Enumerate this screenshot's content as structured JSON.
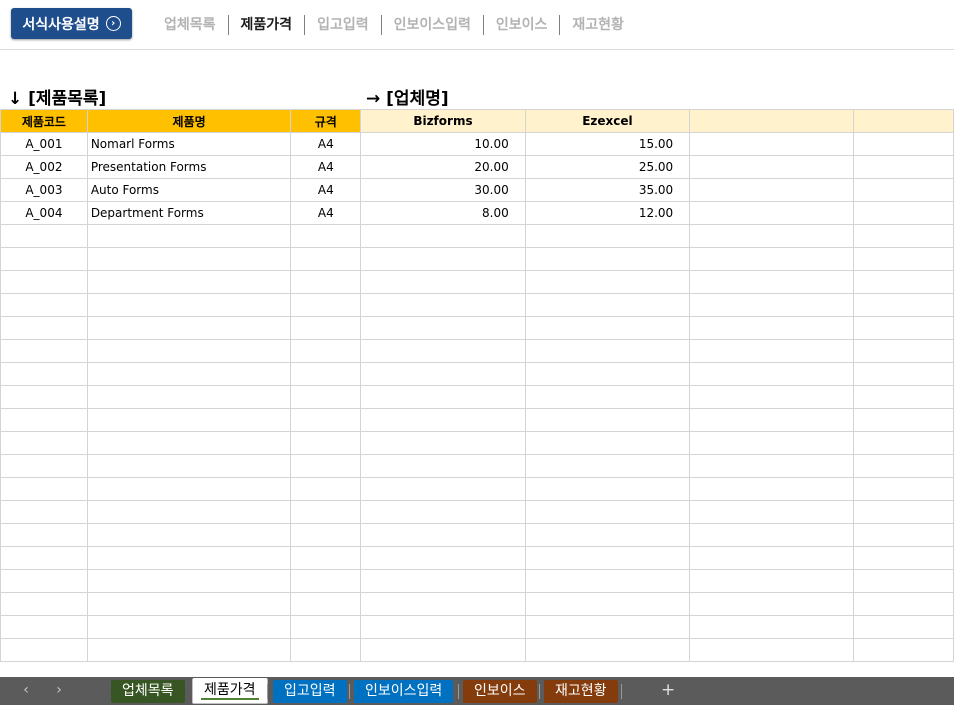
{
  "toolbar": {
    "help_label": "서식사용설명",
    "nav": [
      "업체목록",
      "제품가격",
      "입고입력",
      "인보이스입력",
      "인보이스",
      "재고현황"
    ],
    "active_nav": "제품가격"
  },
  "sections": {
    "product_list": "↓ [제품목록]",
    "vendor_name": "→ [업체명]"
  },
  "table": {
    "headers": [
      "제품코드",
      "제품명",
      "규격",
      "Bizforms",
      "Ezexcel",
      "",
      ""
    ],
    "rows": [
      [
        "A_001",
        "Nomarl Forms",
        "A4",
        "10.00",
        "15.00",
        "",
        ""
      ],
      [
        "A_002",
        "Presentation Forms",
        "A4",
        "20.00",
        "25.00",
        "",
        ""
      ],
      [
        "A_003",
        "Auto Forms",
        "A4",
        "30.00",
        "35.00",
        "",
        ""
      ],
      [
        "A_004",
        "Department Forms",
        "A4",
        "8.00",
        "12.00",
        "",
        ""
      ]
    ]
  },
  "sheet_tabs": [
    {
      "label": "업체목록",
      "color": "#375623"
    },
    {
      "label": "제품가격",
      "color": "#ffffff",
      "active": true
    },
    {
      "label": "입고입력",
      "color": "#0070c0"
    },
    {
      "label": "인보이스입력",
      "color": "#0070c0"
    },
    {
      "label": "인보이스",
      "color": "#843c0c"
    },
    {
      "label": "재고현황",
      "color": "#843c0c"
    }
  ],
  "icons": {
    "help": "chevron-circle-right-icon",
    "prev": "chevron-left-icon",
    "next": "chevron-right-icon",
    "add": "plus-icon"
  }
}
